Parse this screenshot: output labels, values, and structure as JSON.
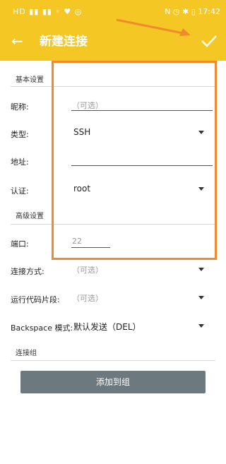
{
  "status_bar": {
    "left_text": "HD ▮▮ ▮▮ ◦ ♥ ◎",
    "right_text": "N ◷ ✱ ▯ 17:42",
    "time": "17:42"
  },
  "app_bar": {
    "title": "新建连接",
    "back_icon": "arrow-left-icon",
    "confirm_icon": "check-icon"
  },
  "sections": {
    "basic": "基本设置",
    "advanced": "高级设置",
    "group": "连接组"
  },
  "fields": {
    "nickname": {
      "label": "昵称:",
      "placeholder": "（可选）"
    },
    "type": {
      "label": "类型:",
      "value": "SSH"
    },
    "address": {
      "label": "地址:",
      "value": ""
    },
    "auth": {
      "label": "认证:",
      "value": "root"
    },
    "port": {
      "label": "端口:",
      "placeholder": "22"
    },
    "connect_method": {
      "label": "连接方式:",
      "placeholder": "（可选）"
    },
    "run_snippet": {
      "label": "运行代码片段:",
      "placeholder": "（可选）"
    },
    "backspace_mode": {
      "label": "Backspace 模式:",
      "value": "默认发送（DEL）"
    }
  },
  "buttons": {
    "add_to_group": "添加到组"
  },
  "colors": {
    "accent": "#f5c724",
    "annotation_orange": "#f08a2c",
    "button_bg": "#6c7a80"
  }
}
